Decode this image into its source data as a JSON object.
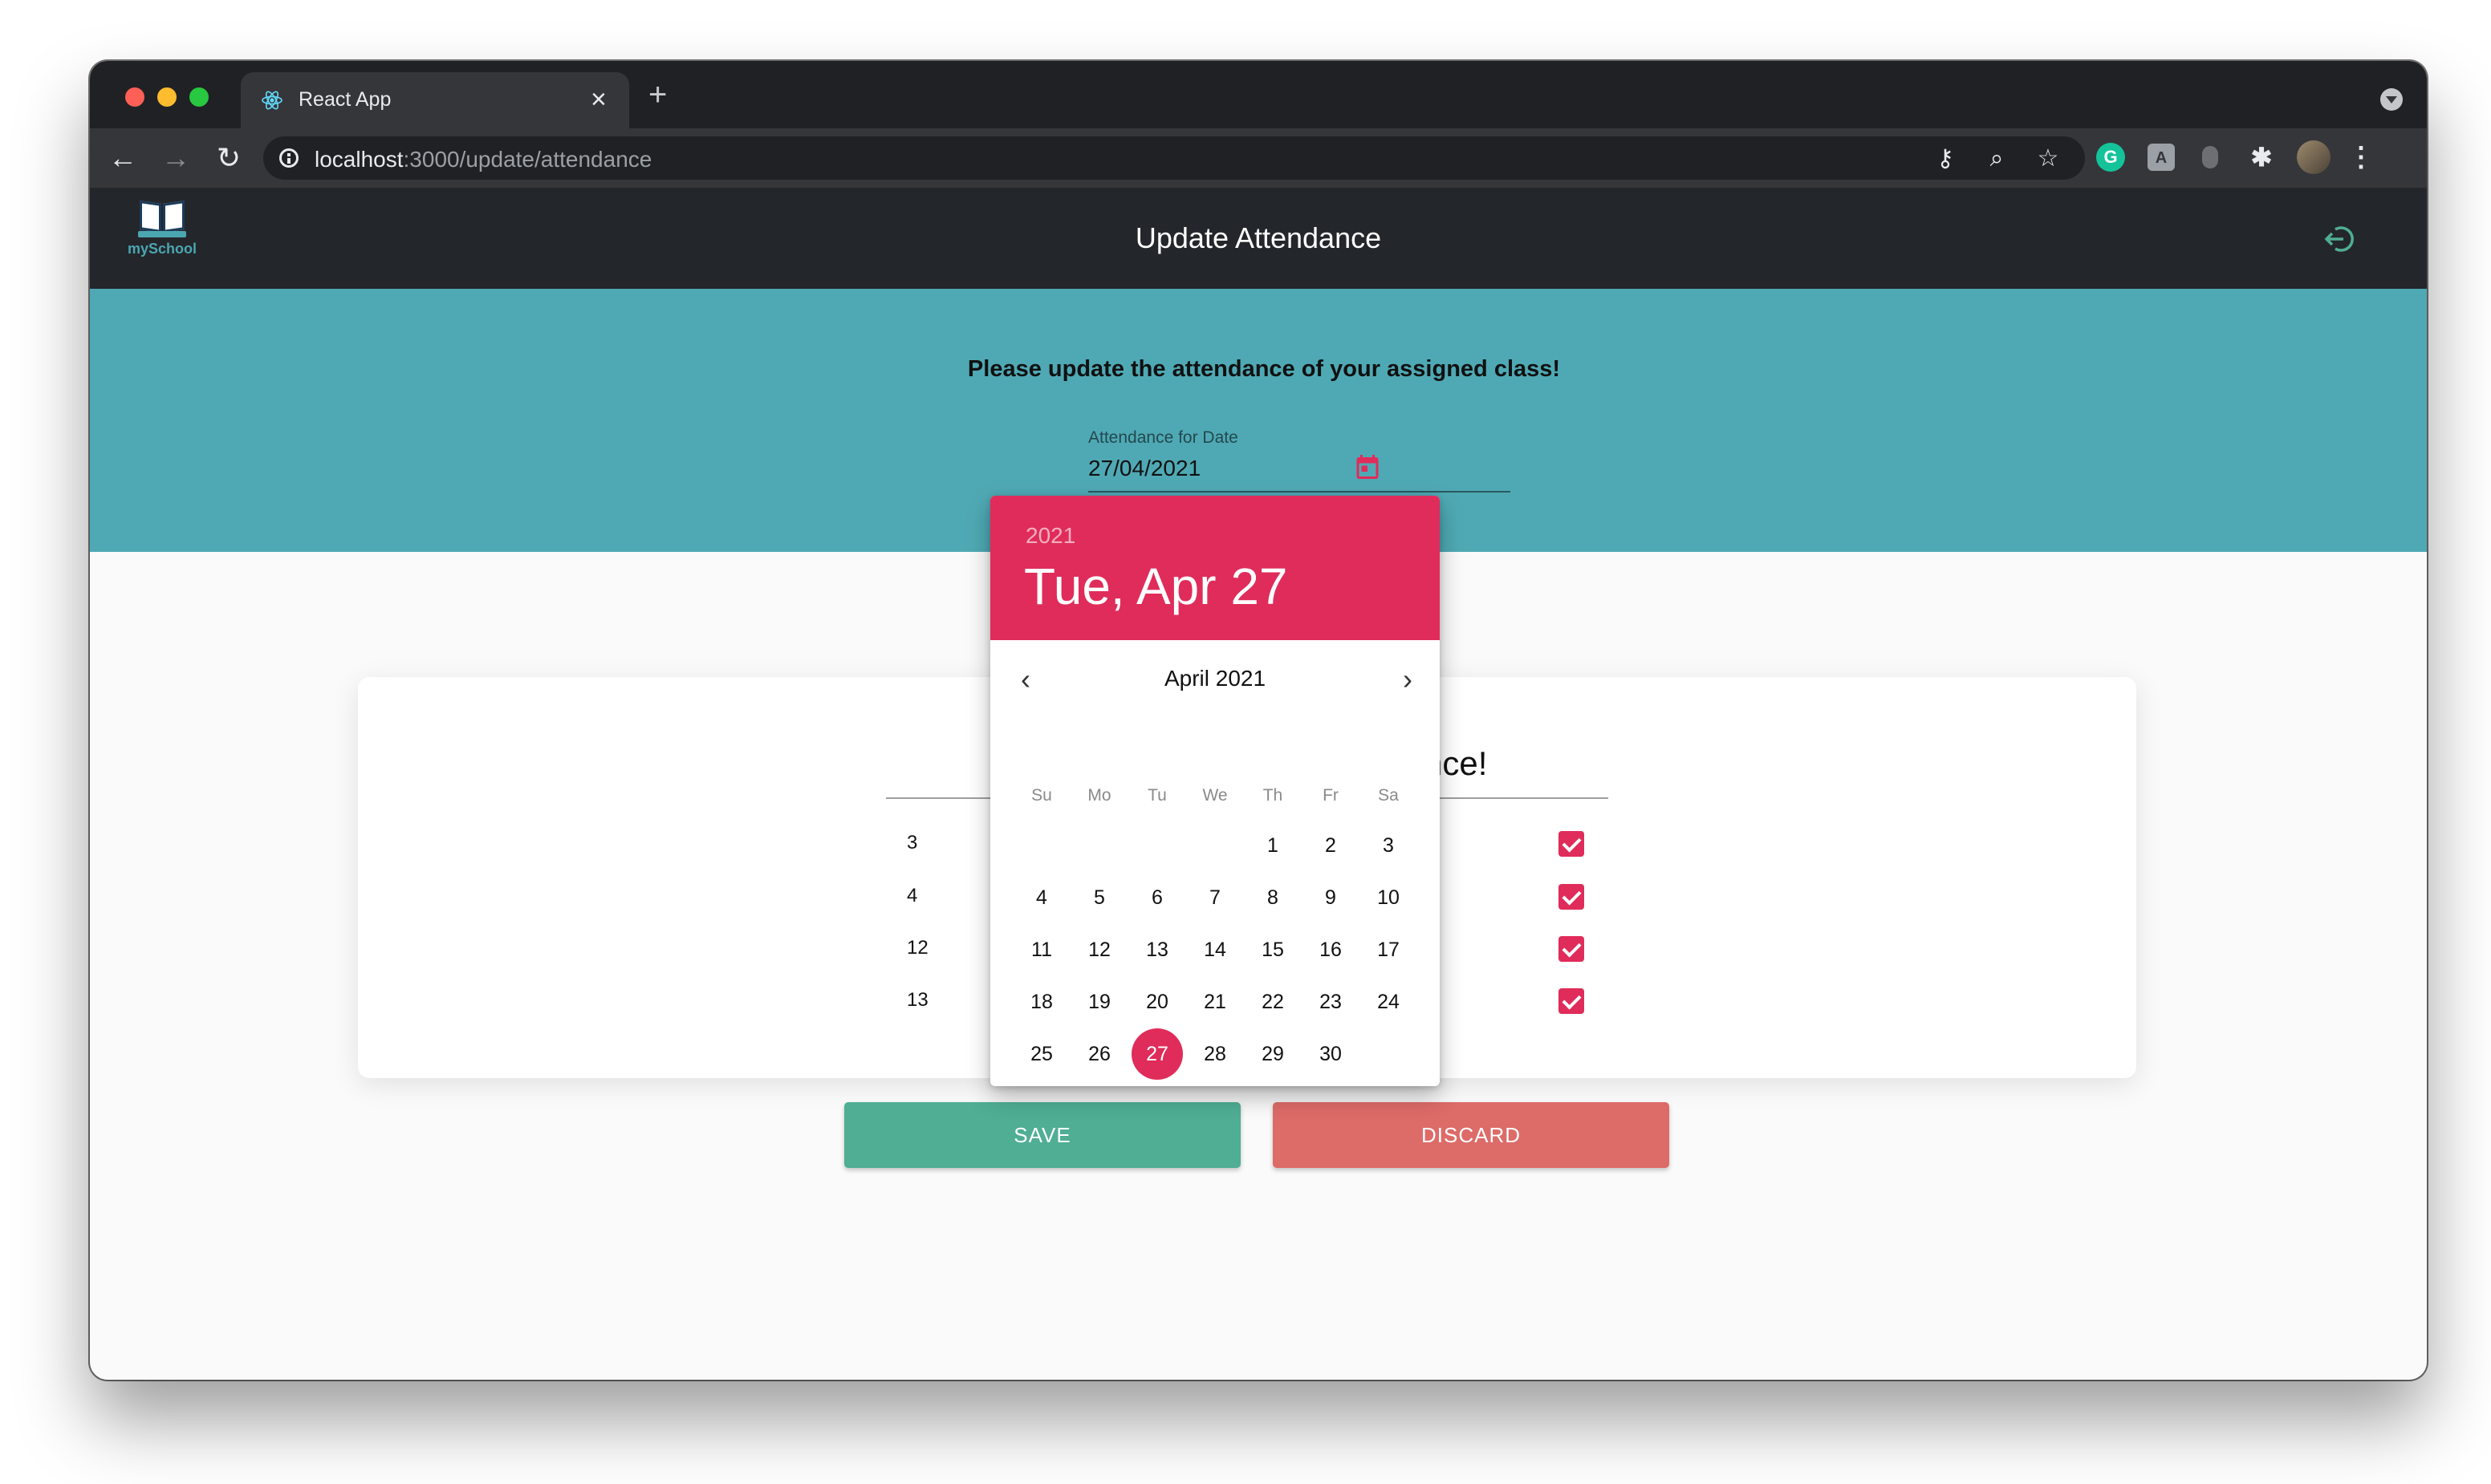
{
  "browser": {
    "tab_title": "React App",
    "tab_close": "×",
    "new_tab": "+",
    "url_host": "localhost",
    "url_path": ":3000/update/attendance"
  },
  "app": {
    "logo_text": "mySchool",
    "title": "Update Attendance"
  },
  "banner": {
    "message": "Please update the attendance of your assigned class!",
    "date_label": "Attendance for Date",
    "date_value": "27/04/2021"
  },
  "card": {
    "heading_fragment": "nce!",
    "rows": [
      {
        "roll": "3",
        "present": true
      },
      {
        "roll": "4",
        "present": true
      },
      {
        "roll": "12",
        "present": true
      },
      {
        "roll": "13",
        "present": true
      }
    ]
  },
  "actions": {
    "save_label": "SAVE",
    "discard_label": "DISCARD"
  },
  "datepicker": {
    "year": "2021",
    "selected_long": "Tue, Apr 27",
    "month_label": "April 2021",
    "weekdays": [
      "Su",
      "Mo",
      "Tu",
      "We",
      "Th",
      "Fr",
      "Sa"
    ],
    "days": [
      "1",
      "2",
      "3",
      "4",
      "5",
      "6",
      "7",
      "8",
      "9",
      "10",
      "11",
      "12",
      "13",
      "14",
      "15",
      "16",
      "17",
      "18",
      "19",
      "20",
      "21",
      "22",
      "23",
      "24",
      "25",
      "26",
      "27",
      "28",
      "29",
      "30"
    ],
    "selected_day": "27",
    "accent_color": "#e02c5a"
  },
  "colors": {
    "banner": "#4fa9b4",
    "header": "#23262b",
    "save": "#4fae94",
    "discard": "#dd6b68"
  }
}
